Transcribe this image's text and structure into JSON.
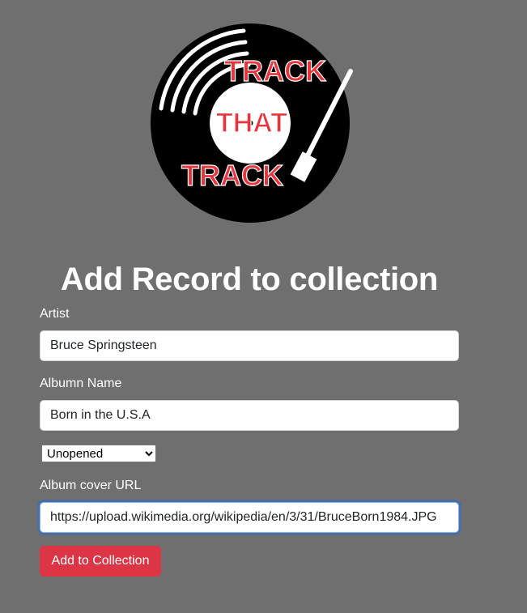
{
  "logo": {
    "line1": "TRACK",
    "line2": "THAT",
    "line3": "TRACK",
    "text_color": "#e8343c",
    "record_color": "#000000"
  },
  "header": {
    "title": "Add Record to collection"
  },
  "form": {
    "artist": {
      "label": "Artist",
      "value": "Bruce Springsteen"
    },
    "album_name": {
      "label": "Albumn Name",
      "value": "Born in the U.S.A"
    },
    "condition": {
      "selected": "Unopened"
    },
    "cover_url": {
      "label": "Album cover URL",
      "value": "https://upload.wikimedia.org/wikipedia/en/3/31/BruceBorn1984.JPG"
    },
    "submit_label": "Add to Collection"
  },
  "colors": {
    "background": "#6f6f6f",
    "button": "#dc3545",
    "focus_ring": "#86b7fe"
  }
}
